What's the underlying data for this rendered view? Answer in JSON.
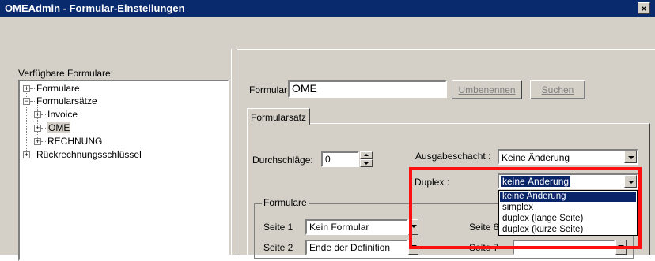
{
  "window": {
    "title": "OMEAdmin - Formular-Einstellungen",
    "close_glyph": "×"
  },
  "left": {
    "label": "Verfügbare Formulare:",
    "tree": [
      {
        "label": "Formulare",
        "level": 0,
        "expander": "+"
      },
      {
        "label": "Formularsätze",
        "level": 0,
        "expander": "−"
      },
      {
        "label": "Invoice",
        "level": 1,
        "expander": "+"
      },
      {
        "label": "OME",
        "level": 1,
        "expander": "+",
        "selected": true
      },
      {
        "label": "RECHNUNG",
        "level": 1,
        "expander": "+"
      },
      {
        "label": "Rückrechnungsschlüssel",
        "level": 0,
        "expander": "+"
      }
    ]
  },
  "right": {
    "formular_label": "Formular:",
    "formular_value": "OME",
    "rename_button": "Umbenennen",
    "search_button": "Suchen",
    "tab_label": "Formularsatz",
    "durchschlaege_label": "Durchschläge:",
    "durchschlaege_value": "0",
    "ausgabeschacht_label": "Ausgabeschacht :",
    "ausgabeschacht_value": "Keine Änderung",
    "duplex_label": "Duplex :",
    "duplex_value": "keine Änderung",
    "duplex_options": [
      "keine Änderung",
      "simplex",
      "duplex (lange Seite)",
      "duplex (kurze Seite)"
    ],
    "formulare_group": "Formulare",
    "seite1_label": "Seite 1",
    "seite1_value": "Kein Formular",
    "seite2_label": "Seite 2",
    "seite2_value": "Ende der Definition",
    "seite6_label": "Seite 6",
    "seite7_label": "Seite 7"
  },
  "colors": {
    "titlebar": "#0a2a6e",
    "highlight": "#ff1010",
    "selection": "#0a246a"
  }
}
